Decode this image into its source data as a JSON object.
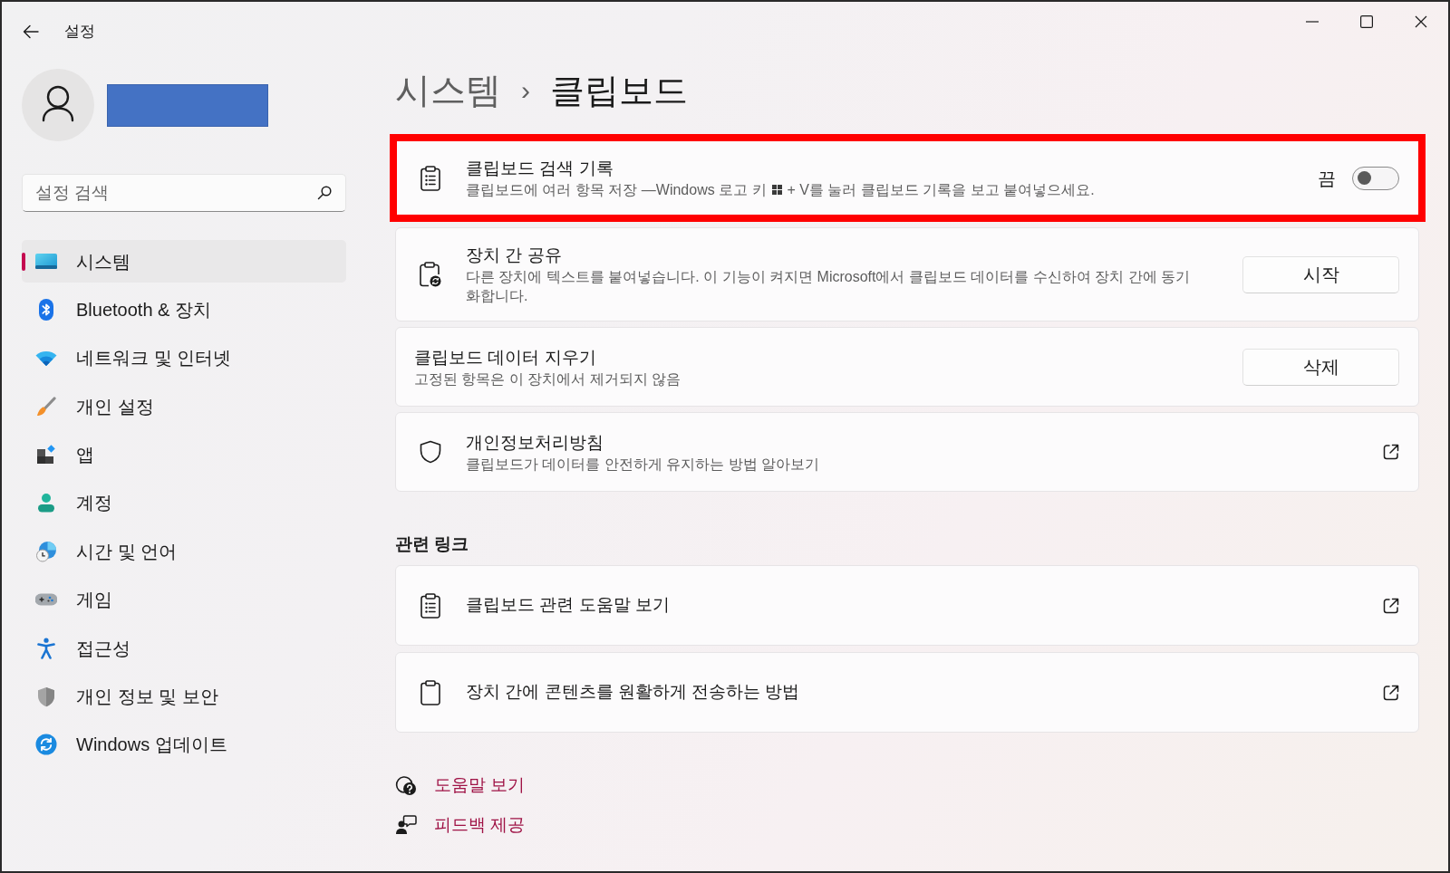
{
  "window": {
    "title": "설정"
  },
  "search": {
    "placeholder": "설정 검색"
  },
  "nav": [
    {
      "label": "시스템",
      "selected": true
    },
    {
      "label": "Bluetooth & 장치",
      "selected": false
    },
    {
      "label": "네트워크 및 인터넷",
      "selected": false
    },
    {
      "label": "개인 설정",
      "selected": false
    },
    {
      "label": "앱",
      "selected": false
    },
    {
      "label": "계정",
      "selected": false
    },
    {
      "label": "시간 및 언어",
      "selected": false
    },
    {
      "label": "게임",
      "selected": false
    },
    {
      "label": "접근성",
      "selected": false
    },
    {
      "label": "개인 정보 및 보안",
      "selected": false
    },
    {
      "label": "Windows 업데이트",
      "selected": false
    }
  ],
  "breadcrumb": {
    "parent": "시스템",
    "separator": "›",
    "current": "클립보드"
  },
  "settings": [
    {
      "kind": "toggle",
      "title": "클립보드 검색 기록",
      "description_parts": [
        {
          "kind": "text",
          "text": "클립보드에 여러 항목 저장 —Windows 로고 키"
        },
        {
          "kind": "windows_key"
        },
        {
          "kind": "text",
          "text": "+ V를 눌러 클립보드 기록을 보고 붙여넣으세요."
        }
      ],
      "state_label": "끔",
      "on": false,
      "highlighted": true
    },
    {
      "kind": "button",
      "title": "장치 간 공유",
      "description": "다른 장치에 텍스트를 붙여넣습니다. 이 기능이 켜지면 Microsoft에서 클립보드 데이터를 수신하여 장치 간에 동기화합니다.",
      "button": "시작",
      "highlighted": false
    },
    {
      "kind": "button",
      "title": "클립보드 데이터 지우기",
      "description": "고정된 항목은 이 장치에서 제거되지 않음",
      "button": "삭제",
      "highlighted": false
    },
    {
      "kind": "link",
      "title": "개인정보처리방침",
      "description": "클립보드가 데이터를 안전하게 유지하는 방법 알아보기",
      "highlighted": false
    }
  ],
  "related": {
    "heading": "관련 링크",
    "links": [
      {
        "label": "클립보드 관련 도움말 보기"
      },
      {
        "label": "장치 간에 콘텐츠를 원활하게 전송하는 방법"
      }
    ]
  },
  "footer_links": [
    {
      "label": "도움말 보기"
    },
    {
      "label": "피드백 제공"
    }
  ]
}
